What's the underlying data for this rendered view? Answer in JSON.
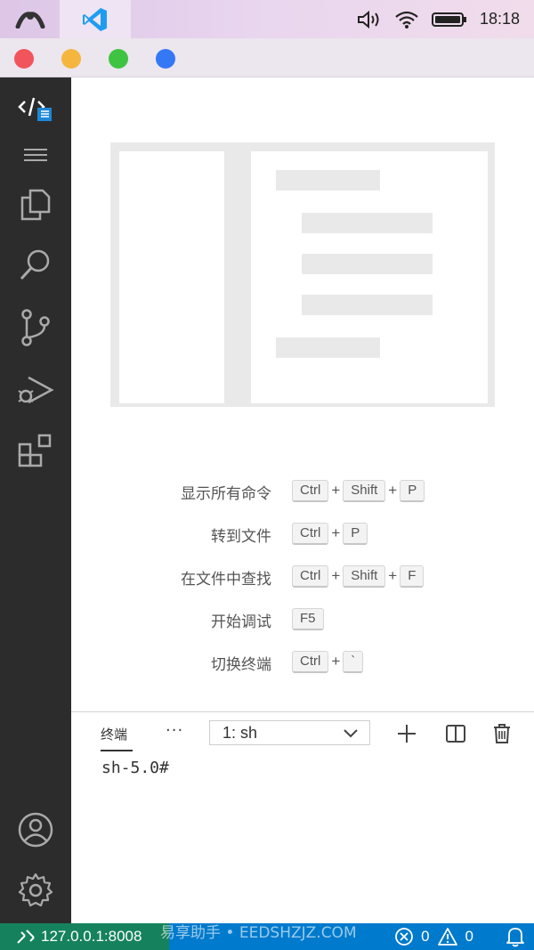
{
  "system_bar": {
    "time": "18:18",
    "app_tab_icon": "vscode-icon",
    "app_menu_icon": "launcher-icon"
  },
  "window_controls": {
    "colors": [
      "#f2545b",
      "#f4b63f",
      "#3fc441",
      "#3478f6"
    ]
  },
  "activity_bar": {
    "items": [
      "vscode-explorer-logo",
      "menu-icon",
      "files-icon",
      "search-icon",
      "source-control-icon",
      "run-debug-icon",
      "extensions-icon"
    ],
    "bottom_items": [
      "account-icon",
      "settings-gear-icon"
    ]
  },
  "welcome": {
    "shortcuts": [
      {
        "label": "显示所有命令",
        "keys": [
          "Ctrl",
          "Shift",
          "P"
        ]
      },
      {
        "label": "转到文件",
        "keys": [
          "Ctrl",
          "P"
        ]
      },
      {
        "label": "在文件中查找",
        "keys": [
          "Ctrl",
          "Shift",
          "F"
        ]
      },
      {
        "label": "开始调试",
        "keys": [
          "F5"
        ]
      },
      {
        "label": "切换终端",
        "keys": [
          "Ctrl",
          "`"
        ]
      }
    ],
    "plus": "+"
  },
  "panel": {
    "tab_label": "终端",
    "more": "···",
    "terminal_select": "1: sh",
    "prompt": "sh-5.0#"
  },
  "status_bar": {
    "remote": "127.0.0.1:8008",
    "errors": "0",
    "warnings": "0",
    "accent": "#007acc",
    "remote_accent": "#16825d"
  },
  "watermark": "易享助手 • EEDSHZJZ.COM"
}
